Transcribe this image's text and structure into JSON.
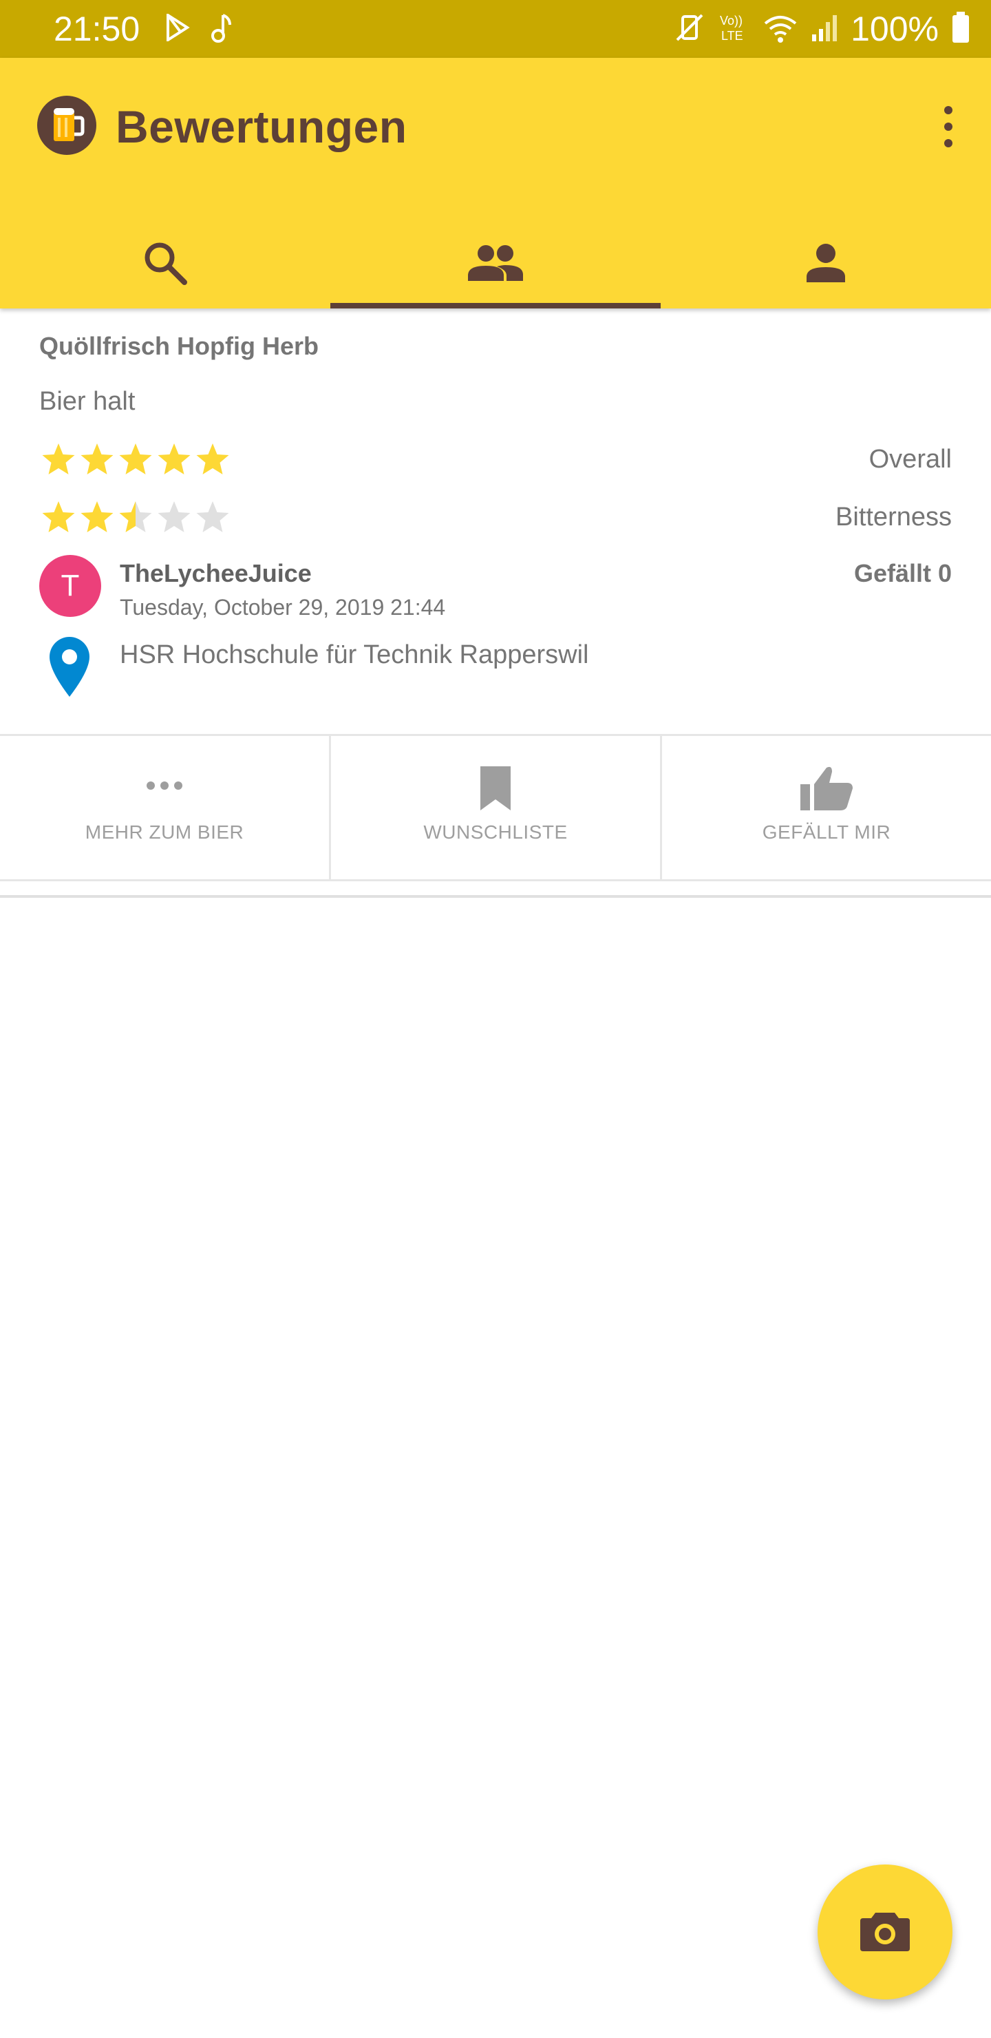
{
  "status_bar": {
    "time": "21:50",
    "battery": "100%",
    "icons": [
      "play-store-icon",
      "music-note-icon",
      "vibrate-mute-icon",
      "volte-icon",
      "wifi-icon",
      "signal-icon",
      "battery-icon"
    ]
  },
  "app_bar": {
    "title": "Bewertungen",
    "logo_icon": "beer-mug-icon",
    "menu_icon": "more-vert-icon"
  },
  "tabs": [
    {
      "icon": "search-icon",
      "selected": false
    },
    {
      "icon": "people-icon",
      "selected": true
    },
    {
      "icon": "person-icon",
      "selected": false
    }
  ],
  "review": {
    "beer_name": "Quöllfrisch Hopfig Herb",
    "comment": "Bier halt",
    "ratings": [
      {
        "label": "Overall",
        "value": 5,
        "max": 5
      },
      {
        "label": "Bitterness",
        "value": 2.5,
        "max": 5
      }
    ],
    "avatar_initial": "T",
    "user": "TheLycheeJuice",
    "date": "Tuesday, October 29, 2019 21:44",
    "likes": "Gefällt 0",
    "location": "HSR Hochschule für Technik Rapperswil"
  },
  "actions": [
    {
      "label": "MEHR ZUM BIER",
      "icon": "more-horiz-icon"
    },
    {
      "label": "WUNSCHLISTE",
      "icon": "bookmark-icon"
    },
    {
      "label": "GEFÄLLT MIR",
      "icon": "thumb-up-icon"
    }
  ],
  "fab": {
    "icon": "camera-icon"
  },
  "colors": {
    "status_bar": "#C8A900",
    "app_bar": "#FDD835",
    "brown": "#5D4037",
    "star_filled": "#FDD835",
    "star_empty": "#E0E0E0",
    "avatar": "#EC407A",
    "pin": "#0288D1"
  }
}
